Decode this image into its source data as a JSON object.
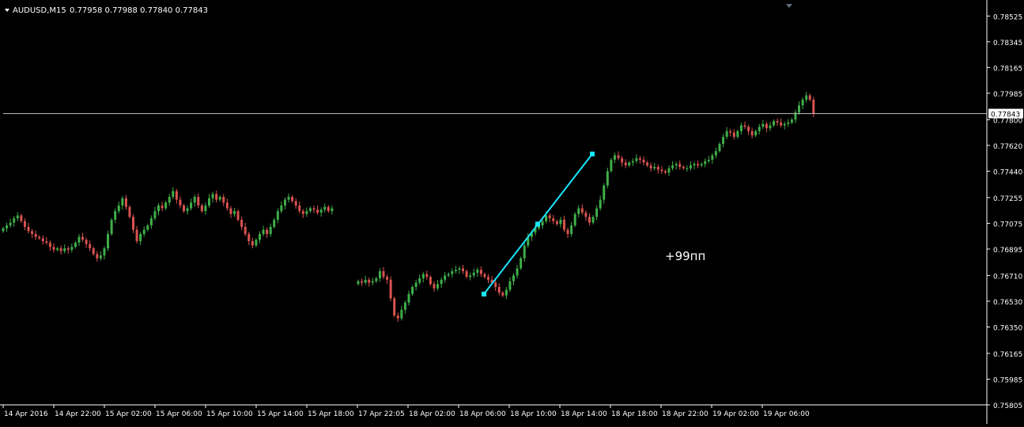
{
  "header": {
    "symbol": "AUDUSD,M15",
    "ohlc": "0.77958 0.77988 0.77840 0.77843"
  },
  "annotation": {
    "text": "+99пп"
  },
  "colors": {
    "background": "#000000",
    "up_candle": "#3fae49",
    "down_candle": "#d9534f",
    "trend_line": "#19e6ff",
    "price_line": "#c0c0c0",
    "axis": "#ffffff"
  },
  "chart_data": {
    "type": "candlestick",
    "timeframe": "M15",
    "ylim": [
      0.75805,
      0.78615
    ],
    "y_ticks": [
      "0.78525",
      "0.78345",
      "0.78165",
      "0.77985",
      "0.77800",
      "0.77620",
      "0.77440",
      "0.77255",
      "0.77075",
      "0.76895",
      "0.76710",
      "0.76530",
      "0.76350",
      "0.76165",
      "0.75985",
      "0.75805"
    ],
    "x_ticks": [
      "14 Apr 2016",
      "14 Apr 22:00",
      "15 Apr 02:00",
      "15 Apr 06:00",
      "15 Apr 10:00",
      "15 Apr 14:00",
      "15 Apr 18:00",
      "17 Apr 22:05",
      "18 Apr 02:00",
      "18 Apr 06:00",
      "18 Apr 10:00",
      "18 Apr 14:00",
      "18 Apr 18:00",
      "18 Apr 22:00",
      "19 Apr 02:00",
      "19 Apr 06:00"
    ],
    "current_price": "0.77843",
    "series": [
      {
        "segment": "14-15 Apr",
        "closes": [
          0.7704,
          0.7706,
          0.7708,
          0.7711,
          0.7713,
          0.7709,
          0.7705,
          0.7702,
          0.77,
          0.7698,
          0.7697,
          0.7695,
          0.7694,
          0.7691,
          0.7689,
          0.769,
          0.7688,
          0.769,
          0.7689,
          0.7691,
          0.7694,
          0.7698,
          0.7696,
          0.7693,
          0.769,
          0.7686,
          0.7683,
          0.7685,
          0.769,
          0.77,
          0.771,
          0.7716,
          0.772,
          0.7725,
          0.7719,
          0.7712,
          0.7703,
          0.7695,
          0.77,
          0.7703,
          0.7706,
          0.7711,
          0.7716,
          0.772,
          0.7718,
          0.7722,
          0.7726,
          0.773,
          0.7724,
          0.772,
          0.7716,
          0.7718,
          0.7722,
          0.7726,
          0.772,
          0.7716,
          0.772,
          0.7725,
          0.7728,
          0.7724,
          0.7726,
          0.7722,
          0.7718,
          0.7714,
          0.7716,
          0.771,
          0.7705,
          0.77,
          0.7695,
          0.7692,
          0.7696,
          0.77,
          0.7703,
          0.77,
          0.7705,
          0.771,
          0.7716,
          0.772,
          0.7724,
          0.7726,
          0.7723,
          0.772,
          0.7716,
          0.7714,
          0.7716,
          0.7718,
          0.7717,
          0.7715,
          0.7717,
          0.7719,
          0.7716,
          0.7718
        ]
      },
      {
        "segment": "17-19 Apr",
        "closes": [
          0.7667,
          0.7666,
          0.7668,
          0.7666,
          0.7667,
          0.7669,
          0.7674,
          0.767,
          0.7668,
          0.7655,
          0.7643,
          0.7641,
          0.7647,
          0.7652,
          0.7658,
          0.7663,
          0.7666,
          0.7669,
          0.7672,
          0.767,
          0.7665,
          0.7662,
          0.7665,
          0.7668,
          0.7671,
          0.7672,
          0.7674,
          0.7675,
          0.7676,
          0.7674,
          0.767,
          0.7671,
          0.7673,
          0.7675,
          0.7672,
          0.767,
          0.7668,
          0.7666,
          0.7663,
          0.7659,
          0.7657,
          0.7661,
          0.7667,
          0.7671,
          0.7676,
          0.7683,
          0.7692,
          0.7698,
          0.7701,
          0.7704,
          0.7706,
          0.7709,
          0.7713,
          0.7711,
          0.7709,
          0.7707,
          0.771,
          0.7703,
          0.77,
          0.7706,
          0.7714,
          0.7718,
          0.7715,
          0.7712,
          0.7708,
          0.7712,
          0.7718,
          0.7724,
          0.7734,
          0.7744,
          0.7752,
          0.7755,
          0.7753,
          0.775,
          0.7748,
          0.775,
          0.7751,
          0.7753,
          0.7752,
          0.775,
          0.7748,
          0.7746,
          0.7747,
          0.7745,
          0.7744,
          0.7743,
          0.7746,
          0.7748,
          0.7749,
          0.7747,
          0.7746,
          0.7746,
          0.7748,
          0.7749,
          0.7748,
          0.7749,
          0.7751,
          0.7752,
          0.7755,
          0.7758,
          0.7763,
          0.7768,
          0.7772,
          0.7771,
          0.7768,
          0.7772,
          0.7776,
          0.7775,
          0.7772,
          0.7769,
          0.7772,
          0.7775,
          0.7777,
          0.7774,
          0.7776,
          0.7779,
          0.7778,
          0.7776,
          0.7777,
          0.7778,
          0.778,
          0.7785,
          0.779,
          0.7794,
          0.7797,
          0.7794,
          0.7784
        ]
      }
    ],
    "trend_line": {
      "from": {
        "x": "18 Apr 06:00",
        "y": 0.7658
      },
      "mid": {
        "x": "18 Apr 10:00",
        "y": 0.7707
      },
      "to": {
        "x": "18 Apr 14:00",
        "y": 0.7756
      }
    }
  }
}
